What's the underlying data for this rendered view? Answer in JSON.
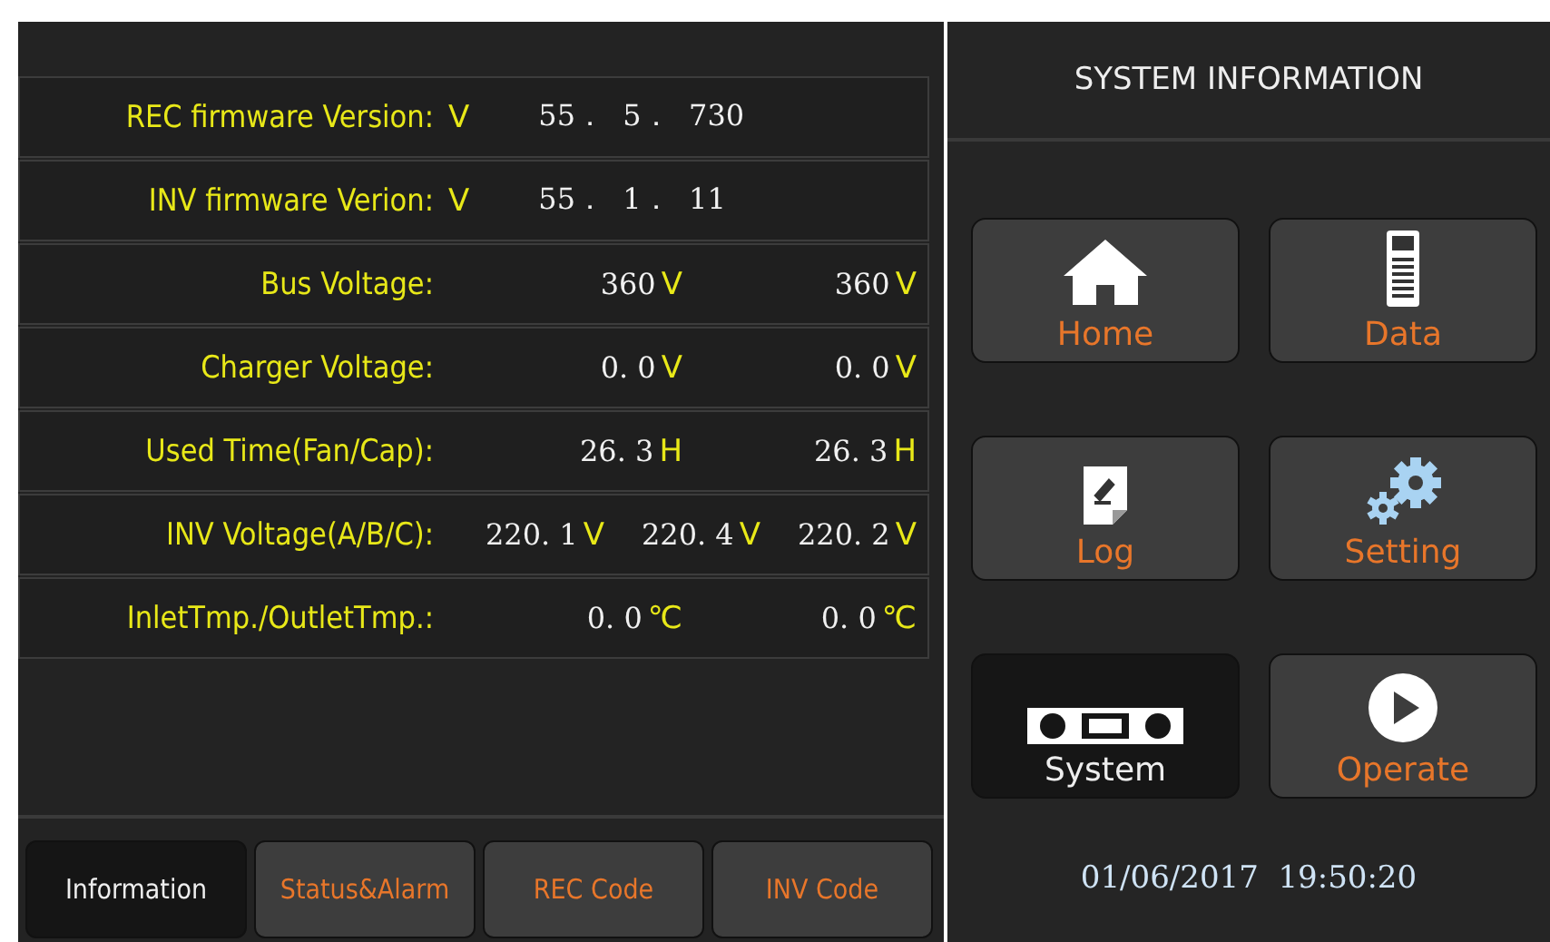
{
  "info_rows": [
    {
      "kind": "version",
      "label": "REC firmware Version:",
      "prefix": "V",
      "value": "55．  5．  730"
    },
    {
      "kind": "version",
      "label": "INV firmware Verion:",
      "prefix": "V",
      "value": "55．  1．  11"
    },
    {
      "kind": "measure",
      "label": "Bus Voltage:",
      "readings": [
        {
          "number": "360",
          "unit": "V"
        },
        {
          "number": "360",
          "unit": "V"
        }
      ]
    },
    {
      "kind": "measure",
      "label": "Charger Voltage:",
      "readings": [
        {
          "number": "0. 0",
          "unit": "V"
        },
        {
          "number": "0. 0",
          "unit": "V"
        }
      ]
    },
    {
      "kind": "measure",
      "label": "Used Time(Fan/Cap):",
      "readings": [
        {
          "number": "26. 3",
          "unit": "H"
        },
        {
          "number": "26. 3",
          "unit": "H"
        }
      ]
    },
    {
      "kind": "measure",
      "label": "INV Voltage(A/B/C):",
      "readings": [
        {
          "number": "220. 1",
          "unit": "V"
        },
        {
          "number": "220. 4",
          "unit": "V"
        },
        {
          "number": "220. 2",
          "unit": "V"
        }
      ]
    },
    {
      "kind": "measure",
      "label": "InletTmp./OutletTmp.:",
      "readings": [
        {
          "number": "0. 0",
          "unit": "℃"
        },
        {
          "number": "0. 0",
          "unit": "℃"
        }
      ]
    }
  ],
  "tabs": [
    {
      "label": "Information",
      "selected": true
    },
    {
      "label": "Status&Alarm",
      "selected": false
    },
    {
      "label": "REC Code",
      "selected": false
    },
    {
      "label": "INV Code",
      "selected": false
    }
  ],
  "side_panel": {
    "title": "SYSTEM INFORMATION",
    "buttons": [
      {
        "label": "Home",
        "selected": false
      },
      {
        "label": "Data",
        "selected": false
      },
      {
        "label": "Log",
        "selected": false
      },
      {
        "label": "Setting",
        "selected": false
      },
      {
        "label": "System",
        "selected": true
      },
      {
        "label": "Operate",
        "selected": false
      }
    ],
    "datetime": "01/06/2017  19:50:20"
  }
}
